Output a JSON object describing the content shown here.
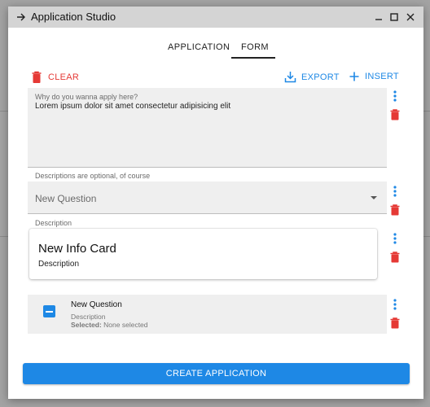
{
  "window": {
    "title": "Application Studio"
  },
  "tabs": [
    {
      "label": "APPLICATION",
      "active": false
    },
    {
      "label": "FORM",
      "active": true
    }
  ],
  "toolbar": {
    "clear_label": "CLEAR",
    "export_label": "EXPORT",
    "insert_label": "INSERT"
  },
  "fields": {
    "textarea": {
      "label": "Why do you wanna apply here?",
      "value": "Lorem ipsum dolor sit amet consectetur adipisicing elit",
      "helper": "Descriptions are optional, of course"
    },
    "select": {
      "value": "New Question",
      "helper": "Description"
    },
    "info_card": {
      "title": "New Info Card",
      "description": "Description"
    },
    "question": {
      "title": "New Question",
      "description": "Description",
      "selected_label": "Selected:",
      "selected_value": "None selected"
    }
  },
  "create_label": "CREATE APPLICATION",
  "colors": {
    "accent": "#1e88e5",
    "danger": "#e53935"
  },
  "icons": [
    "arrow-right-icon",
    "minimize-icon",
    "maximize-icon",
    "close-icon",
    "trash-icon",
    "download-icon",
    "plus-icon",
    "kebab-icon",
    "checkbox-indeterminate-icon",
    "chevron-down-icon"
  ]
}
